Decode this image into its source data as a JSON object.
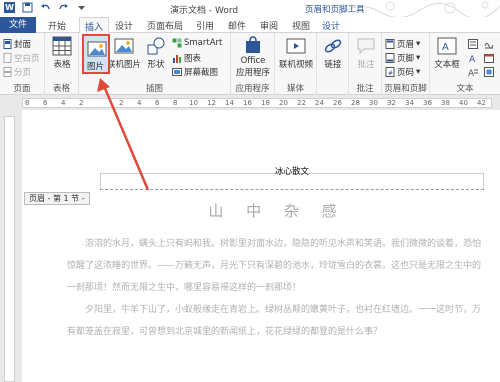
{
  "window": {
    "title": "演示文档 - Word",
    "contextual_tab_group": "页眉和页脚工具"
  },
  "tabs": [
    "文件",
    "开始",
    "插入",
    "设计",
    "页面布局",
    "引用",
    "邮件",
    "审阅",
    "视图",
    "设计"
  ],
  "active_tab": "插入",
  "ribbon": {
    "pages_group": {
      "label": "页面",
      "items": [
        "封面",
        "空白页",
        "分页"
      ]
    },
    "tables_group": {
      "label": "表格",
      "items": [
        "表格"
      ]
    },
    "illustrations_group": {
      "label": "插图",
      "picture": "图片",
      "online_picture": "联机图片",
      "shapes": "形状",
      "smartart": "SmartArt",
      "chart": "图表",
      "screenshot": "屏幕截图"
    },
    "apps_group": {
      "label": "应用程序",
      "office_apps_line1": "Office",
      "office_apps_line2": "应用程序"
    },
    "media_group": {
      "label": "媒体",
      "online_video": "联机视频"
    },
    "links_group": {
      "label": "",
      "links": "链接"
    },
    "comments_group": {
      "label": "批注",
      "comment": "批注"
    },
    "header_footer_group": {
      "label": "页眉和页脚",
      "header": "页眉",
      "footer": "页脚",
      "page_number": "页码"
    },
    "text_group": {
      "label": "文本",
      "textbox": "文本框"
    }
  },
  "ruler": {
    "numbers": [
      "8",
      "6",
      "4",
      "2",
      "2",
      "4",
      "6",
      "8",
      "10",
      "12",
      "14",
      "16",
      "18",
      "20",
      "22",
      "24",
      "26",
      "28",
      "30",
      "32",
      "34",
      "36",
      "38",
      "40",
      "42"
    ]
  },
  "document": {
    "header_text": "冰心散文",
    "section_tag": "页眉 - 第 1 节 -",
    "title": "山 中 杂 感",
    "paragraphs": [
      "溶溶的水月，螨头上只有蚂和我。树影里对面水边，隐隐的听见水声和笑语。我们微微的谈着，恐怕惊醒了这浓睡的世界。——万籁无声，月光下只有深碧的池水，玲珑雪白的衣裳。这也只是无限之生中的一刹那顷！然而无限之生中，哪里容易得这样的一刹那顷！",
      "夕阳里，牛羊下山了，小蚁般缘走在青岩上。绿树丛颠的嫩黄叶子，也衬在红墙边。一一这时节，万有都笼盖在寂里，可曾想到北京城里的新闻纸上，花花绿绿的都登的是什么事？"
    ]
  },
  "colors": {
    "accent": "#2b579a",
    "highlight_border": "#e04a3a",
    "arrow": "#e04a3a"
  }
}
